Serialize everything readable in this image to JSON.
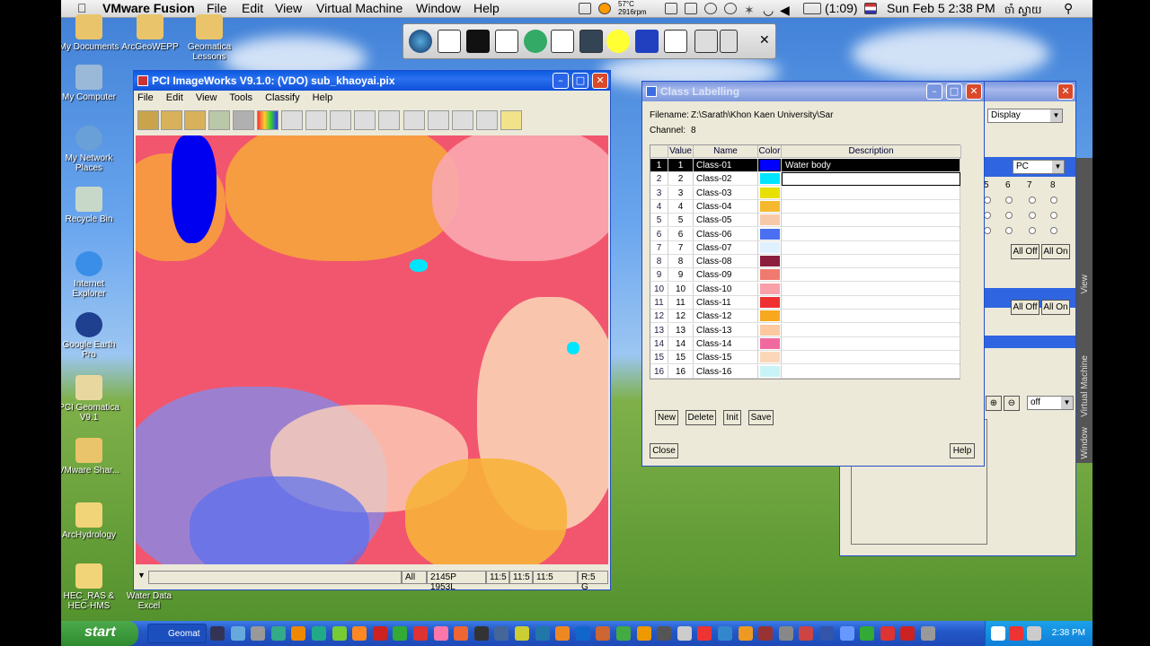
{
  "macbar": {
    "apple": "",
    "app": "VMware Fusion",
    "menus": [
      "File",
      "Edit",
      "View",
      "Virtual Machine",
      "Window",
      "Help"
    ],
    "temp": "57°C",
    "rpm": "2916rpm",
    "battery": "(1:09)",
    "clock": "Sun Feb 5  2:38 PM",
    "user": "ចាំ ស្វាយ"
  },
  "desktop_icons": [
    {
      "label": "My Documents"
    },
    {
      "label": "ArcGeoWEPP"
    },
    {
      "label": "Geomatica Lessons"
    },
    {
      "label": "My Computer"
    },
    {
      "label": "My Network Places"
    },
    {
      "label": "Recycle Bin"
    },
    {
      "label": "Internet Explorer"
    },
    {
      "label": "Google Earth Pro"
    },
    {
      "label": "PCI Geomatica V9.1"
    },
    {
      "label": "VMware Shar..."
    },
    {
      "label": "ArcHydrology"
    },
    {
      "label": "HEC_RAS & HEC-HMS"
    },
    {
      "label": "Water Data Excel"
    }
  ],
  "imageworks": {
    "title": "PCI ImageWorks V9.1.0: (VDO) sub_khaoyai.pix",
    "menus": [
      "File",
      "Edit",
      "View",
      "Tools",
      "Classify",
      "Help"
    ],
    "tool_icons": [
      "open-icon",
      "folder-icon",
      "save-icon",
      "brush-icon",
      "pencil-icon",
      "chart-icon",
      "zoom-in-icon",
      "zoom-out-icon",
      "zoom-fit-icon",
      "zoom-box-icon",
      "rgb-icon",
      "calculator-icon",
      "line-icon",
      "curve-icon",
      "transform-icon",
      "bulb-icon"
    ],
    "status": {
      "mode": "All",
      "coords": "2145P 1953L",
      "pos1": "11:5",
      "pos2": "11:5",
      "pos3": "11:5",
      "channels": "R:5 G"
    }
  },
  "class_labelling": {
    "title": "Class Labelling",
    "filename_label": "Filename:",
    "filename": "Z:\\Sarath\\Khon Kaen University\\Sar",
    "channel_label": "Channel:",
    "channel": "8",
    "headers": [
      "Value",
      "Name",
      "Color",
      "Description"
    ],
    "rows": [
      {
        "idx": "1",
        "value": "1",
        "name": "Class-01",
        "color": "#0000ff",
        "desc": "Water body"
      },
      {
        "idx": "2",
        "value": "2",
        "name": "Class-02",
        "color": "#00e5ff",
        "desc": ""
      },
      {
        "idx": "3",
        "value": "3",
        "name": "Class-03",
        "color": "#e8e000",
        "desc": ""
      },
      {
        "idx": "4",
        "value": "4",
        "name": "Class-04",
        "color": "#f5b82e",
        "desc": ""
      },
      {
        "idx": "5",
        "value": "5",
        "name": "Class-05",
        "color": "#f8c9a8",
        "desc": ""
      },
      {
        "idx": "6",
        "value": "6",
        "name": "Class-06",
        "color": "#4a6ff0",
        "desc": ""
      },
      {
        "idx": "7",
        "value": "7",
        "name": "Class-07",
        "color": "#dff0ff",
        "desc": ""
      },
      {
        "idx": "8",
        "value": "8",
        "name": "Class-08",
        "color": "#8b1e3f",
        "desc": ""
      },
      {
        "idx": "9",
        "value": "9",
        "name": "Class-09",
        "color": "#f07a6e",
        "desc": ""
      },
      {
        "idx": "10",
        "value": "10",
        "name": "Class-10",
        "color": "#f9a0a8",
        "desc": ""
      },
      {
        "idx": "11",
        "value": "11",
        "name": "Class-11",
        "color": "#ee3030",
        "desc": ""
      },
      {
        "idx": "12",
        "value": "12",
        "name": "Class-12",
        "color": "#f8a81e",
        "desc": ""
      },
      {
        "idx": "13",
        "value": "13",
        "name": "Class-13",
        "color": "#fcc9a0",
        "desc": ""
      },
      {
        "idx": "14",
        "value": "14",
        "name": "Class-14",
        "color": "#f06aa0",
        "desc": ""
      },
      {
        "idx": "15",
        "value": "15",
        "name": "Class-15",
        "color": "#fbd7b8",
        "desc": ""
      },
      {
        "idx": "16",
        "value": "16",
        "name": "Class-16",
        "color": "#c8f4f8",
        "desc": ""
      }
    ],
    "buttons": {
      "new": "New",
      "delete": "Delete",
      "init": "Init",
      "save": "Save",
      "close": "Close",
      "help": "Help"
    }
  },
  "side_panel": {
    "display_combo": "Display",
    "pc_combo": "PC",
    "col_headers": [
      "5",
      "6",
      "7",
      "8"
    ],
    "all_off": "All Off",
    "all_on": "All On",
    "off_combo": "off",
    "vm_labels": [
      "View",
      "Virtual Machine",
      "Window"
    ]
  },
  "taskbar": {
    "start": "start",
    "task": "Geomat",
    "clock": "2:38 PM"
  }
}
